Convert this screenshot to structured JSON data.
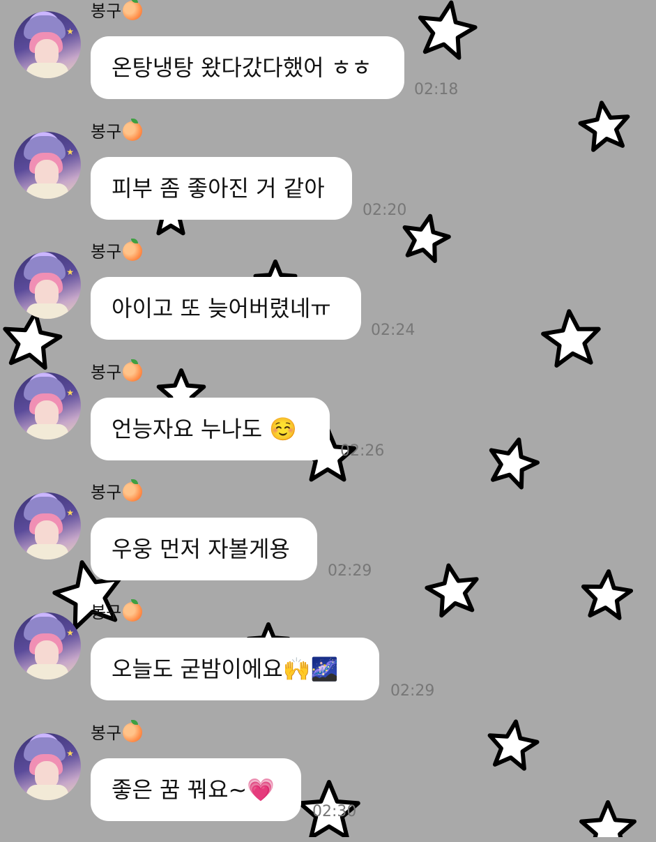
{
  "chat": {
    "messages": [
      {
        "sender": "봉구",
        "sender_emoji": "🍑",
        "text": "온탕냉탕 왔다갔다했어 ㅎㅎ",
        "time": "02:18"
      },
      {
        "sender": "봉구",
        "sender_emoji": "🍑",
        "text": "피부 좀 좋아진 거 같아",
        "time": "02:20"
      },
      {
        "sender": "봉구",
        "sender_emoji": "🍑",
        "text": "아이고 또 늦어버렸네ㅠ",
        "time": "02:24"
      },
      {
        "sender": "봉구",
        "sender_emoji": "🍑",
        "text": "언능자요 누나도 ☺️",
        "time": "02:26"
      },
      {
        "sender": "봉구",
        "sender_emoji": "🍑",
        "text": "우웅 먼저 자볼게용",
        "time": "02:29"
      },
      {
        "sender": "봉구",
        "sender_emoji": "🍑",
        "text": "오늘도 굳밤이에요🙌🌌",
        "time": "02:29"
      },
      {
        "sender": "봉구",
        "sender_emoji": "🍑",
        "text": "좋은 꿈 꿔요~💗",
        "time": "02:30"
      }
    ]
  },
  "colors": {
    "background": "#a9a9a9",
    "bubble": "#ffffff",
    "timestamp": "#777777",
    "star_outline": "#000000",
    "star_fill": "#ffffff"
  }
}
